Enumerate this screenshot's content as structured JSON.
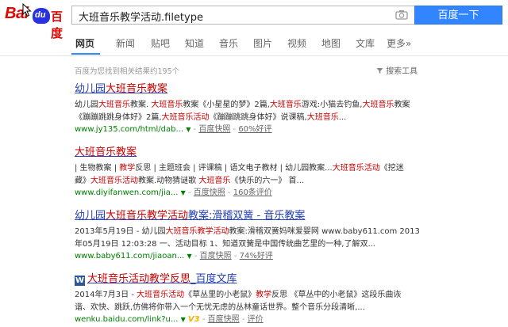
{
  "header": {
    "logo_bai": "Bai",
    "logo_du": "du",
    "logo_cn": "百度",
    "query": "大班音乐教学活动.filetype",
    "search_button": "百度一下"
  },
  "tabs": [
    {
      "label": "网页",
      "active": true
    },
    {
      "label": "新闻"
    },
    {
      "label": "贴吧"
    },
    {
      "label": "知道"
    },
    {
      "label": "音乐"
    },
    {
      "label": "图片"
    },
    {
      "label": "视频"
    },
    {
      "label": "地图"
    },
    {
      "label": "文库"
    },
    {
      "label": "更多»"
    }
  ],
  "stats": "百度为您找到相关结果约195个",
  "tools": "搜索工具",
  "results": [
    {
      "title": [
        "幼儿园",
        "大班音乐教案",
        ""
      ],
      "abs1": [
        "幼儿园",
        "大班音乐",
        "教案. ",
        "大班音乐",
        "教案《小星星的梦》2篇,",
        "大班音乐",
        "游戏:小猫去钓鱼,",
        "大班音乐",
        "教案"
      ],
      "abs2": [
        "《蹦蹦跳跳身体好》2篇,",
        "大班音乐活动",
        "《蹦蹦跳跳身体好》说课稿,",
        "大班音乐",
        "..."
      ],
      "url": "www.jy135.com/html/dab...",
      "snapshot": "百度快照",
      "rating": "60%好评"
    },
    {
      "title": [
        "",
        "大班音乐教案",
        ""
      ],
      "abs1": [
        "| 生物教案 | ",
        "教学",
        "反思 | 主题班会 | 评课稿 | 语文电子教材 | 幼儿园教案...",
        "大班音乐活动",
        "《挖迷"
      ],
      "abs2": [
        "藏》",
        "大班音乐活动",
        "教案.动物猜谜歌 ",
        "大班音乐",
        "《快乐的六一》 首..."
      ],
      "url": "www.diyifanwen.com/jia...",
      "snapshot": "百度快照",
      "rating": "160条评价"
    },
    {
      "title": [
        "幼儿园",
        "大班音乐教学活动",
        "教案:滑稽双簧 - 音乐教案"
      ],
      "abs1": [
        "2013年5月19日 - 幼儿园",
        "大班音乐教学活动",
        "教案:滑稽双簧妈咪爱婴网 www.baby611.com 2013"
      ],
      "abs2": [
        "年05月19日 12:03:28 一、活动目标 1、知道双簧是中国传统曲艺里的一种,了解双..."
      ],
      "url": "www.baby611.com/jiaoan...",
      "snapshot": "百度快照",
      "rating": "74%好评"
    },
    {
      "title": [
        "",
        "大班音乐活动教学反思",
        "_百度文库"
      ],
      "abs1": [
        "2014年7月3日 - ",
        "大班音乐活动",
        "《草丛里的小老鼠》",
        "教学",
        "反思 《草丛中的小老鼠》这段乐曲诙"
      ],
      "abs2": [
        "谐、欢快、跳跃,仿佛将你带入一个无忧无虑的丛林童话世界。整个音乐分段清晰,..."
      ],
      "url": "wenku.baidu.com/link?u...",
      "v3": "V3",
      "snapshot": "百度快照",
      "rating": "评价"
    }
  ],
  "icons": [
    "mouse-cursor-icon",
    "camera-icon",
    "tools-funnel-icon",
    "word-doc-icon",
    "dropdown-triangle-icon"
  ]
}
